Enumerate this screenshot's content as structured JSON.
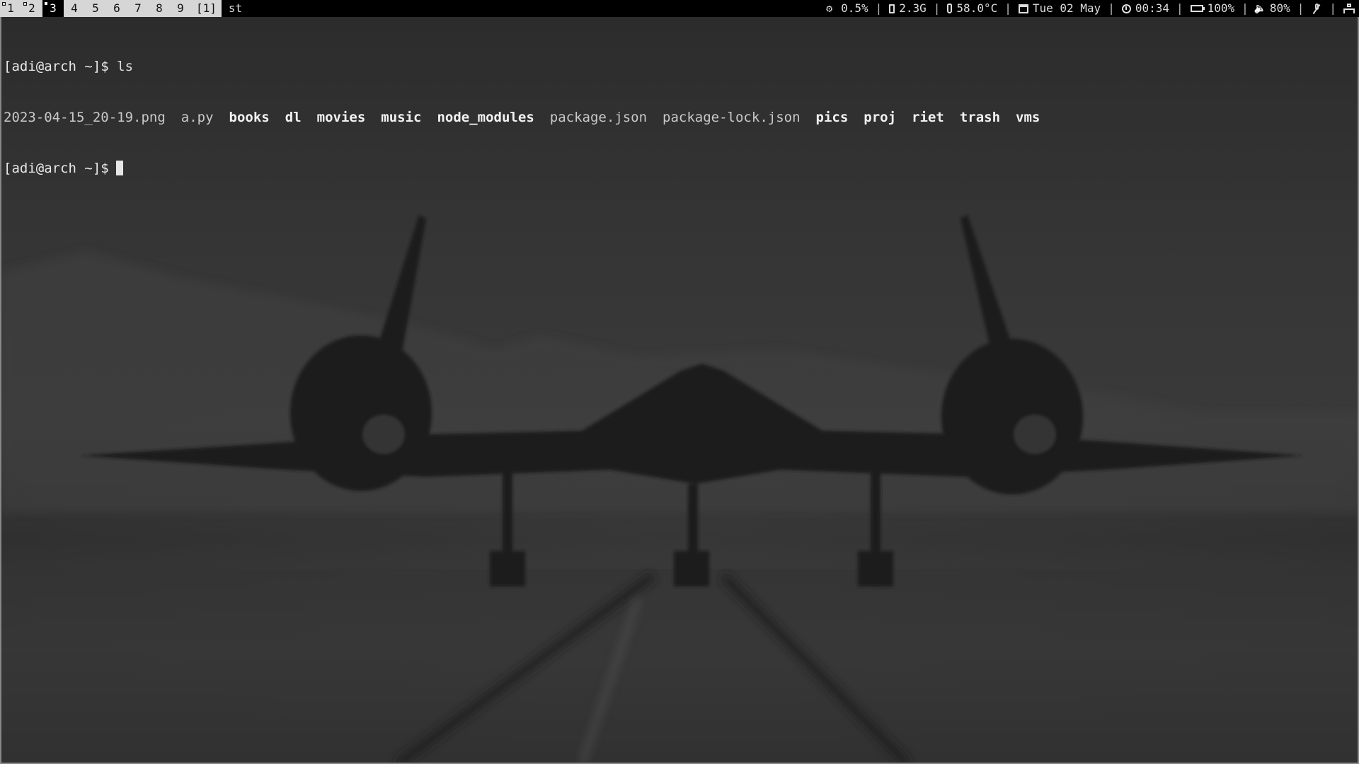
{
  "bar": {
    "tags": [
      {
        "label": "1",
        "occupied": "hollow",
        "selected": false
      },
      {
        "label": "2",
        "occupied": "hollow",
        "selected": false
      },
      {
        "label": "3",
        "occupied": "filled",
        "selected": true
      },
      {
        "label": "4",
        "occupied": "none",
        "selected": false
      },
      {
        "label": "5",
        "occupied": "none",
        "selected": false
      },
      {
        "label": "6",
        "occupied": "none",
        "selected": false
      },
      {
        "label": "7",
        "occupied": "none",
        "selected": false
      },
      {
        "label": "8",
        "occupied": "none",
        "selected": false
      },
      {
        "label": "9",
        "occupied": "none",
        "selected": false
      }
    ],
    "layout_symbol": "[1]",
    "window_title": "st",
    "status": {
      "cpu": {
        "icon": "gears-icon",
        "value": "0.5%"
      },
      "memory": {
        "icon": "memory-icon",
        "value": "2.3G"
      },
      "temperature": {
        "icon": "thermometer-icon",
        "value": "58.0°C"
      },
      "date": {
        "icon": "calendar-icon",
        "value": "Tue 02 May"
      },
      "time": {
        "icon": "clock-icon",
        "value": "00:34"
      },
      "battery": {
        "icon": "battery-icon",
        "value": "100%"
      },
      "volume": {
        "icon": "volume-icon",
        "value": "80%"
      },
      "mic": {
        "icon": "mic-muted-icon"
      },
      "network": {
        "icon": "network-icon"
      }
    }
  },
  "terminal": {
    "prompt": "[adi@arch ~]$",
    "command": "ls",
    "ls_output": [
      {
        "name": "2023-04-15_20-19.png",
        "type": "file"
      },
      {
        "name": "a.py",
        "type": "file"
      },
      {
        "name": "books",
        "type": "dir"
      },
      {
        "name": "dl",
        "type": "dir"
      },
      {
        "name": "movies",
        "type": "dir"
      },
      {
        "name": "music",
        "type": "dir"
      },
      {
        "name": "node_modules",
        "type": "dir"
      },
      {
        "name": "package.json",
        "type": "file"
      },
      {
        "name": "package-lock.json",
        "type": "file"
      },
      {
        "name": "pics",
        "type": "dir"
      },
      {
        "name": "proj",
        "type": "dir"
      },
      {
        "name": "riet",
        "type": "dir"
      },
      {
        "name": "trash",
        "type": "dir"
      },
      {
        "name": "vms",
        "type": "dir"
      }
    ],
    "prompt2": "[adi@arch ~]$"
  },
  "colors": {
    "bar_bg": "#d6d6d6",
    "bar_selected_bg": "#000000",
    "status_bg": "#000000",
    "terminal_fg": "#dcdcdc"
  }
}
